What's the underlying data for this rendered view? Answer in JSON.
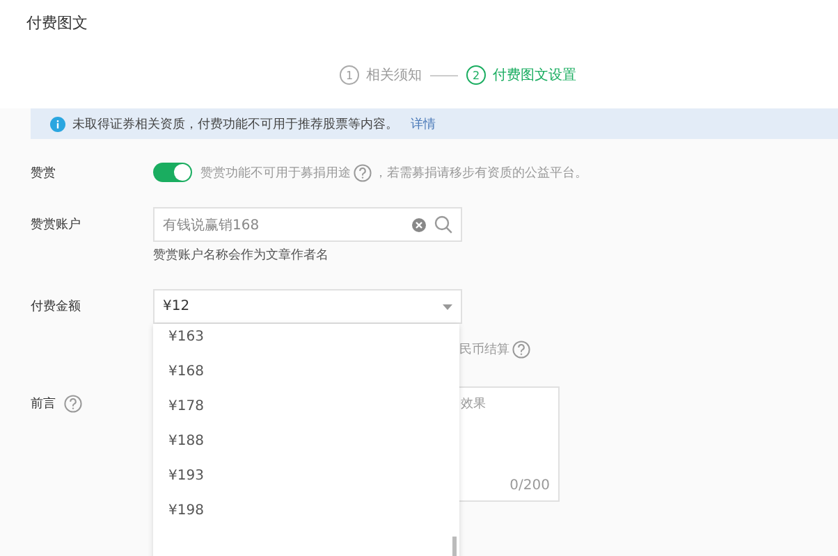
{
  "page_title": "付费图文",
  "steps": [
    {
      "number": "1",
      "label": "相关须知",
      "selected": false
    },
    {
      "number": "2",
      "label": "付费图文设置",
      "selected": true
    }
  ],
  "notice": {
    "text": "未取得证券相关资质，付费功能不可用于推荐股票等内容。",
    "link": "详情"
  },
  "form": {
    "reward": {
      "label": "赞赏",
      "on": true,
      "note_before": "赞赏功能不可用于募捐用途",
      "note_after": "，若需募捐请移步有资质的公益平台。"
    },
    "account": {
      "label": "赞赏账户",
      "value": "有钱说赢销168",
      "hint": "赞赏账户名称会作为文章作者名"
    },
    "price": {
      "label": "付费金额",
      "value": "¥12",
      "note": "民币结算",
      "expanded": true,
      "options": [
        {
          "label": "¥163",
          "selected": false
        },
        {
          "label": "¥168",
          "selected": false
        },
        {
          "label": "¥178",
          "selected": false
        },
        {
          "label": "¥188",
          "selected": false
        },
        {
          "label": "¥193",
          "selected": false
        },
        {
          "label": "¥198",
          "selected": false
        }
      ]
    },
    "preface": {
      "label": "前言",
      "placeholder": "效果",
      "counter": "0/200"
    }
  }
}
